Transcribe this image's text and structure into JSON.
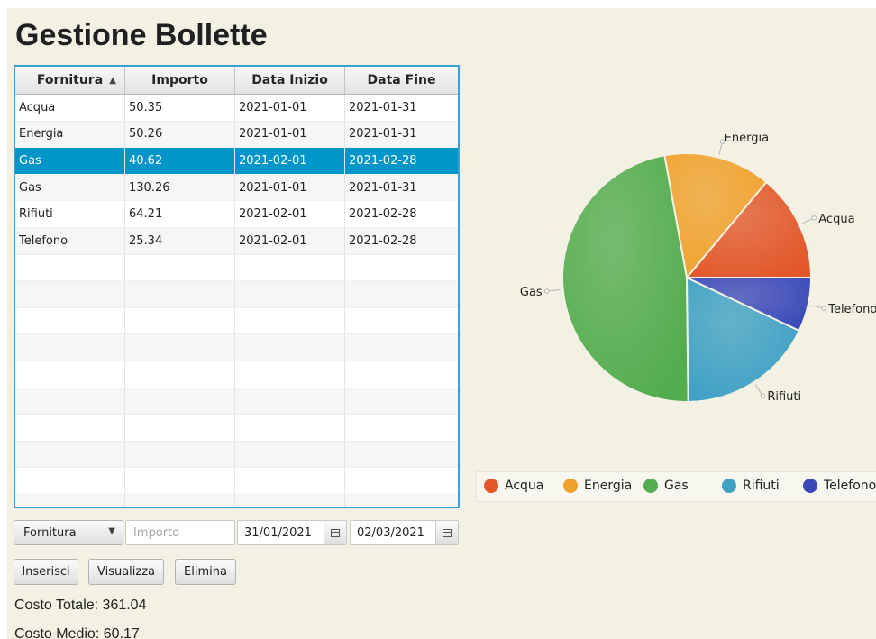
{
  "title": "Gestione Bollette",
  "table": {
    "columns": [
      "Fornitura",
      "Importo",
      "Data Inizio",
      "Data Fine"
    ],
    "sort_column": "Fornitura",
    "sort_direction": "ascending",
    "selected_row": 2,
    "rows": [
      [
        "Acqua",
        "50.35",
        "2021-01-01",
        "2021-01-31"
      ],
      [
        "Energia",
        "50.26",
        "2021-01-01",
        "2021-01-31"
      ],
      [
        "Gas",
        "40.62",
        "2021-02-01",
        "2021-02-28"
      ],
      [
        "Gas",
        "130.26",
        "2021-01-01",
        "2021-01-31"
      ],
      [
        "Rifiuti",
        "64.21",
        "2021-02-01",
        "2021-02-28"
      ],
      [
        "Telefono",
        "25.34",
        "2021-02-01",
        "2021-02-28"
      ]
    ]
  },
  "form": {
    "fornitura_select": "Fornitura",
    "importo_placeholder": "Importo",
    "date_from": "31/01/2021",
    "date_to": "02/03/2021"
  },
  "buttons": {
    "inserisci": "Inserisci",
    "visualizza": "Visualizza",
    "elimina": "Elimina"
  },
  "summary": {
    "costo_totale": "Costo Totale:  361.04",
    "costo_medio": "Costo Medio:  60.17"
  },
  "icons": {
    "sort": "triangle-up",
    "dropdown": "chevron-down",
    "calendar": "calendar"
  },
  "colors": {
    "selection": "#0096c9",
    "table_border": "#3aa0d6",
    "background": "#f3f1e3"
  },
  "chart_data": {
    "type": "pie",
    "categories": [
      "Acqua",
      "Energia",
      "Gas",
      "Rifiuti",
      "Telefono"
    ],
    "values": [
      50.35,
      50.26,
      170.88,
      64.21,
      25.34
    ],
    "colors": [
      "#e2572a",
      "#f0a12c",
      "#53ac4e",
      "#3da0c4",
      "#3a49b8"
    ],
    "legend": [
      "Acqua",
      "Energia",
      "Gas",
      "Rifiuti",
      "Telefono"
    ],
    "legend_placement": "bottom",
    "slice_order": "counterclockwise from 3 o'clock"
  }
}
